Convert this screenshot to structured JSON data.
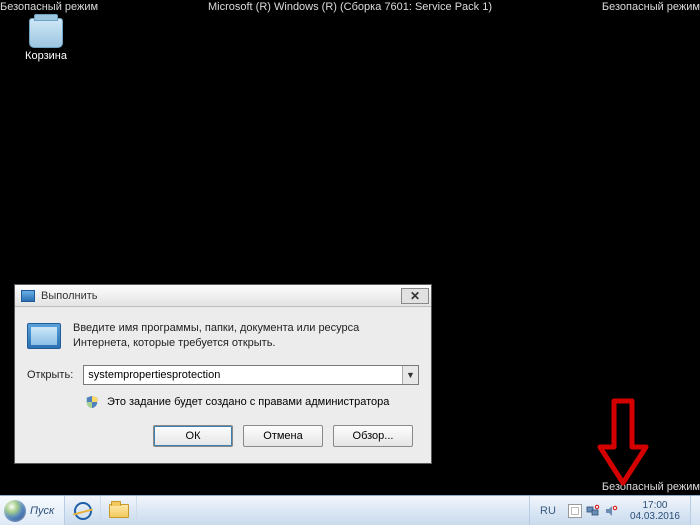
{
  "safe_mode": {
    "corner_label": "Безопасный режим",
    "top_center": "Microsoft (R) Windows (R) (Сборка 7601: Service Pack 1)"
  },
  "desktop": {
    "recycle_bin_label": "Корзина"
  },
  "run_dialog": {
    "title": "Выполнить",
    "description": "Введите имя программы, папки, документа или ресурса Интернета, которые требуется открыть.",
    "open_label": "Открыть:",
    "open_value": "systempropertiesprotection",
    "admin_note": "Это задание будет создано с правами администратора",
    "buttons": {
      "ok": "ОК",
      "cancel": "Отмена",
      "browse": "Обзор..."
    },
    "close_symbol": "✕"
  },
  "taskbar": {
    "start_label": "Пуск",
    "lang": "RU",
    "time": "17:00",
    "date": "04.03.2016"
  }
}
